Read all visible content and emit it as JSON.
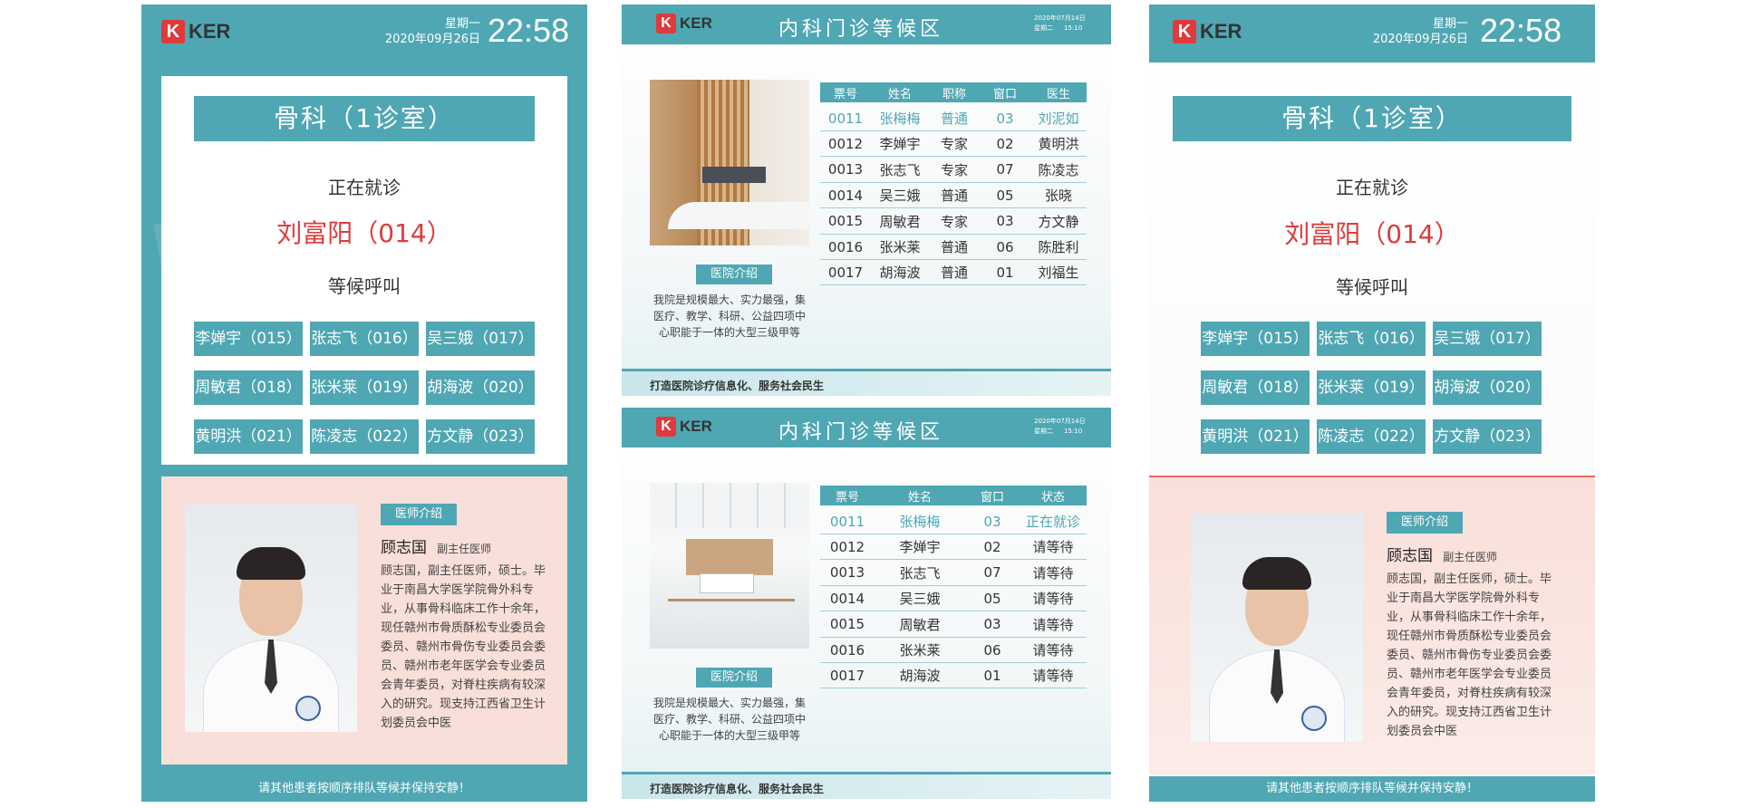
{
  "brand": {
    "logo_letter": "K",
    "logo_text": "KER"
  },
  "colors": {
    "teal": "#4fa7b3",
    "red": "#e03a3a",
    "pink": "#f9dfd9"
  },
  "left": {
    "weekday": "星期一",
    "date": "2020年09月26日",
    "time": "22:58",
    "dept": "骨科（1诊室）",
    "now_label": "正在就诊",
    "now_patient": "刘富阳（014）",
    "wait_label": "等候呼叫",
    "waiting": [
      "李婵宇（015）",
      "张志飞（016）",
      "吴三娥（017）",
      "周敏君（018）",
      "张米莱（019）",
      "胡海波（020）",
      "黄明洪（021）",
      "陈凌志（022）",
      "方文静（023）"
    ],
    "doctor_tag": "医师介绍",
    "doctor_name": "顾志国",
    "doctor_title": "副主任医师",
    "bio": "顾志国，副主任医师，硕士。毕业于南昌大学医学院骨外科专业，从事骨科临床工作十余年，现任赣州市骨质酥松专业委员会委员、赣州市骨伤专业委员会委员、赣州市老年医学会专业委员会青年委员，对脊柱疾病有较深入的研究。现支持江西省卫生计划委员会中医",
    "footer": "请其他患者按顺序排队等候并保持安静！"
  },
  "mid_top": {
    "title": "内科门诊等候区",
    "date": "2020年07月14日",
    "weekday": "星期二",
    "time": "15:10",
    "headers": [
      "票号",
      "姓名",
      "职称",
      "窗口",
      "医生"
    ],
    "rows": [
      [
        "0011",
        "张梅梅",
        "普通",
        "03",
        "刘泥如"
      ],
      [
        "0012",
        "李婵宇",
        "专家",
        "02",
        "黄明洪"
      ],
      [
        "0013",
        "张志飞",
        "专家",
        "07",
        "陈凌志"
      ],
      [
        "0014",
        "吴三娥",
        "普通",
        "05",
        "张晓"
      ],
      [
        "0015",
        "周敏君",
        "专家",
        "03",
        "方文静"
      ],
      [
        "0016",
        "张米莱",
        "普通",
        "06",
        "陈胜利"
      ],
      [
        "0017",
        "胡海波",
        "普通",
        "01",
        "刘福生"
      ]
    ],
    "intro_tag": "医院介绍",
    "intro": "我院是规模最大、实力最强，集医疗、教学、科研、公益四项中心职能于一体的大型三级甲等",
    "footer": "打造医院诊疗信息化、服务社会民生"
  },
  "mid_bottom": {
    "title": "内科门诊等候区",
    "date": "2020年07月14日",
    "weekday": "星期二",
    "time": "15:10",
    "headers": [
      "票号",
      "姓名",
      "窗口",
      "状态"
    ],
    "rows": [
      [
        "0011",
        "张梅梅",
        "03",
        "正在就诊"
      ],
      [
        "0012",
        "李婵宇",
        "02",
        "请等待"
      ],
      [
        "0013",
        "张志飞",
        "07",
        "请等待"
      ],
      [
        "0014",
        "吴三娥",
        "05",
        "请等待"
      ],
      [
        "0015",
        "周敏君",
        "03",
        "请等待"
      ],
      [
        "0016",
        "张米莱",
        "06",
        "请等待"
      ],
      [
        "0017",
        "胡海波",
        "01",
        "请等待"
      ]
    ],
    "intro_tag": "医院介绍",
    "intro": "我院是规模最大、实力最强，集医疗、教学、科研、公益四项中心职能于一体的大型三级甲等",
    "footer": "打造医院诊疗信息化、服务社会民生"
  },
  "right": {
    "weekday": "星期一",
    "date": "2020年09月26日",
    "time": "22:58",
    "dept": "骨科（1诊室）",
    "now_label": "正在就诊",
    "now_patient": "刘富阳（014）",
    "wait_label": "等候呼叫",
    "waiting": [
      "李婵宇（015）",
      "张志飞（016）",
      "吴三娥（017）",
      "周敏君（018）",
      "张米莱（019）",
      "胡海波（020）",
      "黄明洪（021）",
      "陈凌志（022）",
      "方文静（023）"
    ],
    "doctor_tag": "医师介绍",
    "doctor_name": "顾志国",
    "doctor_title": "副主任医师",
    "bio": "顾志国，副主任医师，硕士。毕业于南昌大学医学院骨外科专业，从事骨科临床工作十余年，现任赣州市骨质酥松专业委员会委员、赣州市骨伤专业委员会委员、赣州市老年医学会专业委员会青年委员，对脊柱疾病有较深入的研究。现支持江西省卫生计划委员会中医",
    "footer": "请其他患者按顺序排队等候并保持安静！"
  }
}
